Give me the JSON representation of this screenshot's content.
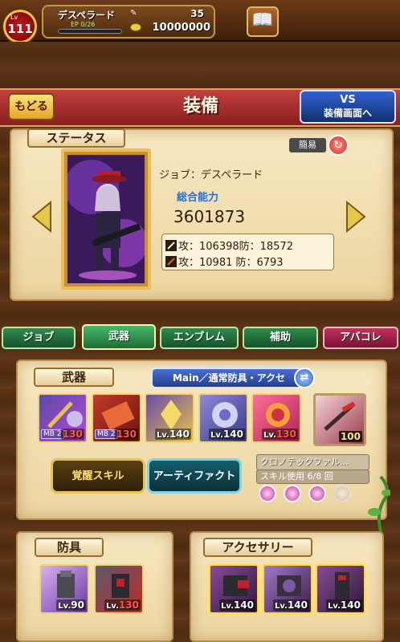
{
  "player": {
    "level_label": "Lv",
    "level": "111",
    "name": "デスペラード",
    "ep_label": "EP  0/26",
    "gems": "35",
    "gold": "10000000"
  },
  "header": {
    "back_label": "もどる",
    "title": "装備",
    "vs_line1": "VS",
    "vs_line2": "装備画面へ"
  },
  "status": {
    "title": "ステータス",
    "simple_label": "簡易",
    "job_line": "ジョブ：デスペラード",
    "total_label": "総合能力",
    "total_value": "3601873",
    "phys_stats": "攻：106398防：18572",
    "magic_stats": "攻：10981  防：6793"
  },
  "tabs": {
    "job": "ジョブ",
    "weapon": "武器",
    "emblem": "エンブレム",
    "support": "補助",
    "abacolle": "アバコレ"
  },
  "weapon": {
    "title": "武器",
    "loadout_label": "Main／通常防具・アクセ",
    "slots": [
      {
        "mb": "MB 2",
        "level": "130",
        "level_red": true
      },
      {
        "mb": "MB 2",
        "level": "130",
        "level_red": true
      },
      {
        "lv": "Lv.",
        "level": "140",
        "level_red": false
      },
      {
        "lv": "Lv.",
        "level": "140",
        "level_red": false
      },
      {
        "lv": "Lv.",
        "level": "130",
        "level_red": true
      }
    ],
    "artifact_slot_level": "100",
    "skill_button": "覚醒スキル",
    "artifact_button": "アーティファクト",
    "artifact_name": "クロノテックファル…",
    "artifact_uses": "スキル使用 6/8 回"
  },
  "armor": {
    "title": "防具",
    "slots": [
      {
        "lv": "Lv.",
        "level": "90",
        "level_red": false
      },
      {
        "lv": "Lv.",
        "level": "130",
        "level_red": true
      }
    ]
  },
  "accessory": {
    "title": "アクセサリー",
    "slots": [
      {
        "lv": "Lv.",
        "level": "140",
        "level_red": false
      },
      {
        "lv": "Lv.",
        "level": "140",
        "level_red": false
      },
      {
        "lv": "Lv.",
        "level": "140",
        "level_red": false
      }
    ]
  }
}
